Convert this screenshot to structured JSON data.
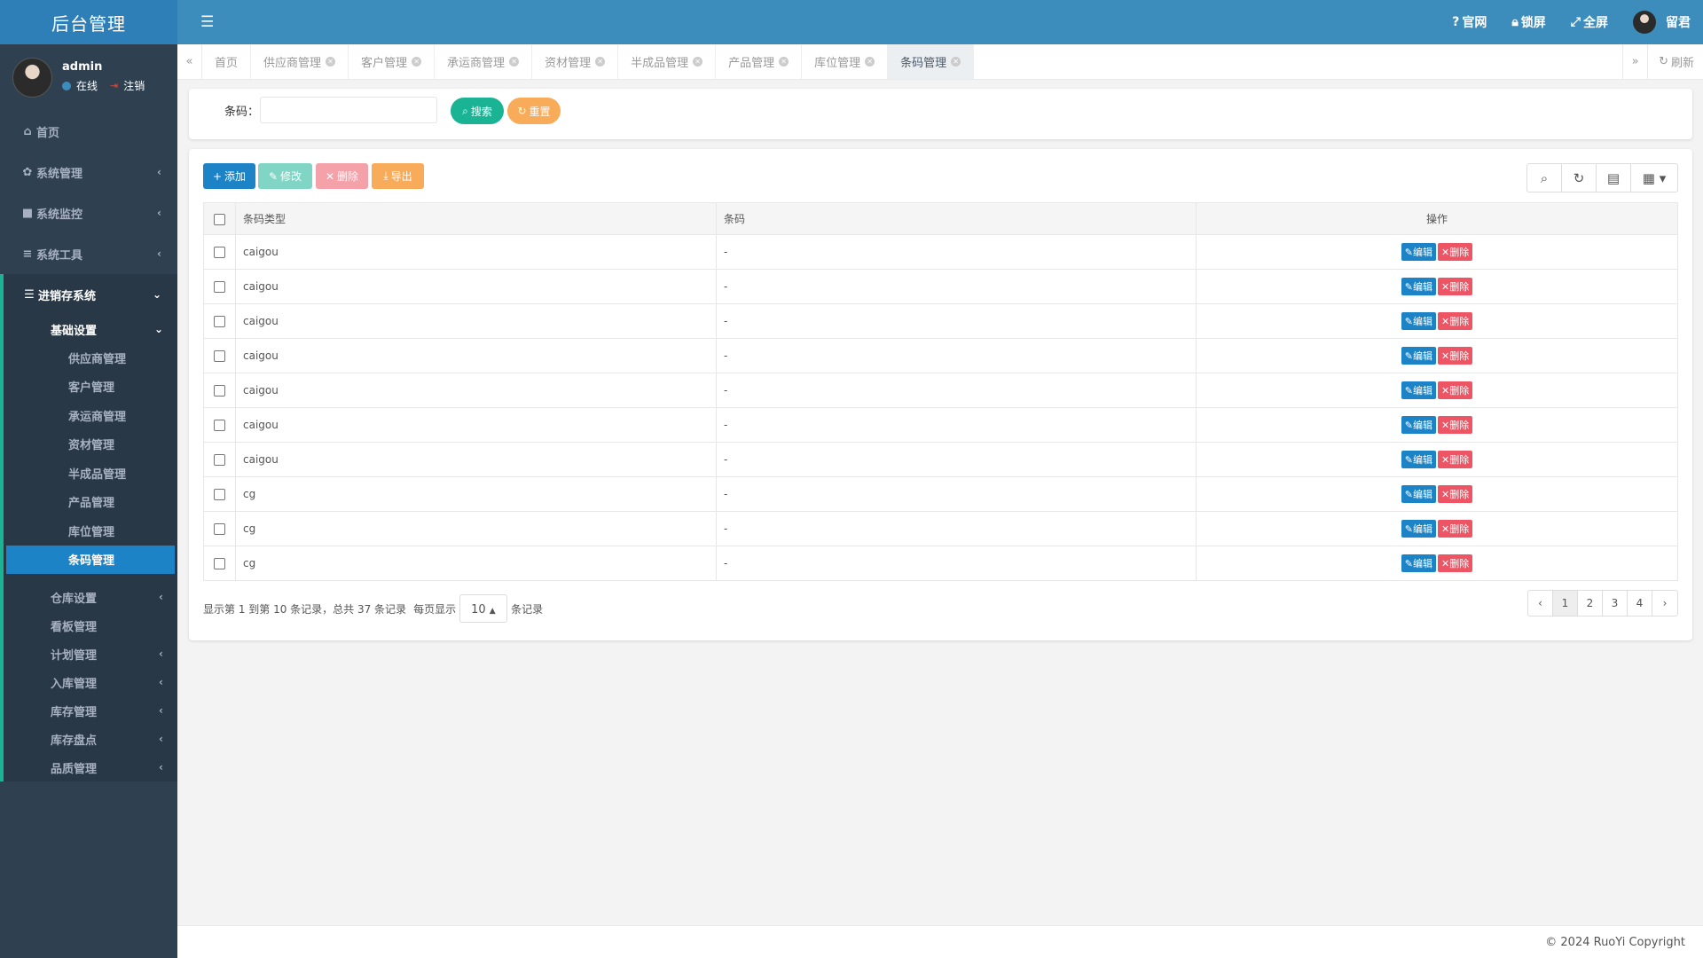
{
  "app": {
    "title": "后台管理"
  },
  "user": {
    "name": "admin",
    "status": "在线",
    "logout": "注销"
  },
  "sidebar": {
    "items": [
      {
        "label": "首页",
        "icon": "home-icon"
      },
      {
        "label": "系统管理",
        "icon": "gear-icon"
      },
      {
        "label": "系统监控",
        "icon": "video-icon"
      },
      {
        "label": "系统工具",
        "icon": "bars-icon"
      },
      {
        "label": "进销存系统",
        "icon": "database-icon"
      }
    ],
    "sub_open": {
      "label": "基础设置"
    },
    "leaf": [
      "供应商管理",
      "客户管理",
      "承运商管理",
      "资材管理",
      "半成品管理",
      "产品管理",
      "库位管理",
      "条码管理"
    ],
    "sub_rest": [
      "仓库设置",
      "看板管理",
      "计划管理",
      "入库管理",
      "库存管理",
      "库存盘点",
      "品质管理"
    ]
  },
  "topbar": {
    "official": "官网",
    "lock": "锁屏",
    "fullscreen": "全屏",
    "user": "留君"
  },
  "tabs": [
    "首页",
    "供应商管理",
    "客户管理",
    "承运商管理",
    "资材管理",
    "半成品管理",
    "产品管理",
    "库位管理",
    "条码管理"
  ],
  "tabbar": {
    "refresh": "刷新"
  },
  "search": {
    "label": "条码：",
    "search_btn": "搜索",
    "reset_btn": "重置",
    "value": ""
  },
  "toolbar": {
    "add": "添加",
    "edit": "修改",
    "delete": "删除",
    "export": "导出"
  },
  "table": {
    "headers": [
      "条码类型",
      "条码",
      "操作"
    ],
    "rows": [
      [
        "caigou",
        "-"
      ],
      [
        "caigou",
        "-"
      ],
      [
        "caigou",
        "-"
      ],
      [
        "caigou",
        "-"
      ],
      [
        "caigou",
        "-"
      ],
      [
        "caigou",
        "-"
      ],
      [
        "caigou",
        "-"
      ],
      [
        "cg",
        "-"
      ],
      [
        "cg",
        "-"
      ],
      [
        "cg",
        "-"
      ]
    ],
    "op_edit": "编辑",
    "op_delete": "删除"
  },
  "pagination": {
    "info": "显示第 1 到第 10 条记录，总共 37 条记录",
    "per_page_label": "每页显示",
    "per_page": "10",
    "records_label": "条记录",
    "pages": [
      "‹",
      "1",
      "2",
      "3",
      "4",
      "›"
    ],
    "active": "1"
  },
  "footer": {
    "copyright": "© 2024 RuoYi Copyright"
  }
}
